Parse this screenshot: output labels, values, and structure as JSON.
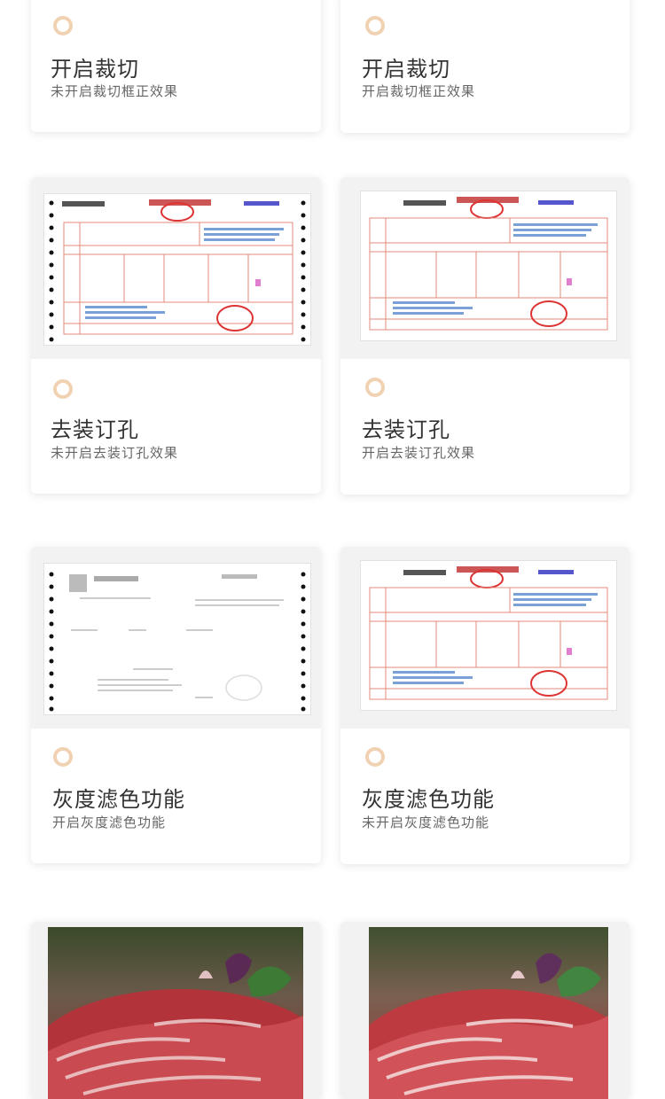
{
  "accent_color": "#f0d2b3",
  "cards": [
    {
      "title": "开启裁切",
      "desc": "未开启裁切框正效果"
    },
    {
      "title": "开启裁切",
      "desc": "开启裁切框正效果"
    },
    {
      "title": "去装订孔",
      "desc": "未开启去装订孔效果"
    },
    {
      "title": "去装订孔",
      "desc": "开启去装订孔效果"
    },
    {
      "title": "灰度滤色功能",
      "desc": "开启灰度滤色功能"
    },
    {
      "title": "灰度滤色功能",
      "desc": "未开启灰度滤色功能"
    }
  ]
}
